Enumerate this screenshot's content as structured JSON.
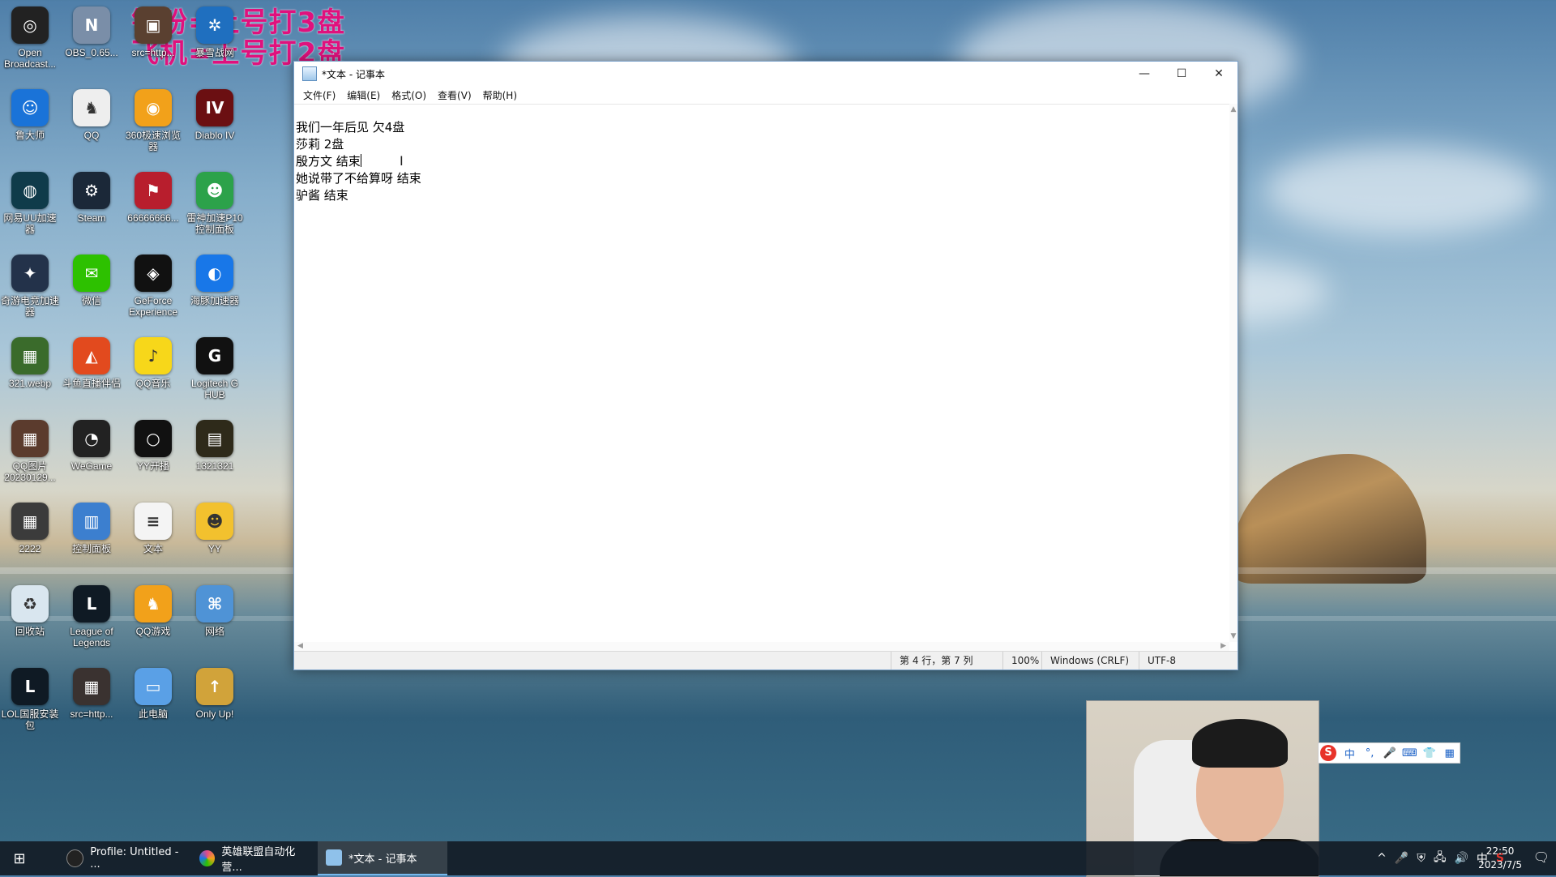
{
  "overlay": {
    "line1": "钻粉=上号打3盘",
    "line2": "飞机=上号打2盘"
  },
  "desktop_icons": [
    {
      "label": "Open Broadcast...",
      "color": "#222222",
      "glyph": "◎"
    },
    {
      "label": "OBS_0.65...",
      "color": "#7a8ea8",
      "glyph": "N"
    },
    {
      "label": "src=http...",
      "color": "#5a4030",
      "glyph": "▣"
    },
    {
      "label": "暴雪战网",
      "color": "#1f6fbf",
      "glyph": "✲"
    },
    {
      "label": "鲁大师",
      "color": "#1a73d8",
      "glyph": "☺"
    },
    {
      "label": "QQ",
      "color": "#eeeeee",
      "glyph": "♞"
    },
    {
      "label": "360极速浏览器",
      "color": "#f2a11a",
      "glyph": "◉"
    },
    {
      "label": "Diablo IV",
      "color": "#6b0f12",
      "glyph": "IV"
    },
    {
      "label": "网易UU加速器",
      "color": "#0f3b4a",
      "glyph": "◍"
    },
    {
      "label": "Steam",
      "color": "#1b2838",
      "glyph": "⚙"
    },
    {
      "label": "66666666...",
      "color": "#b81e2d",
      "glyph": "⚑"
    },
    {
      "label": "雷神加速P10控制面板",
      "color": "#2ca24a",
      "glyph": "☻"
    },
    {
      "label": "奇游电竞加速器",
      "color": "#23324a",
      "glyph": "✦"
    },
    {
      "label": "微信",
      "color": "#2dc100",
      "glyph": "✉"
    },
    {
      "label": "GeForce Experience",
      "color": "#111111",
      "glyph": "◈"
    },
    {
      "label": "海豚加速器",
      "color": "#1877e8",
      "glyph": "◐"
    },
    {
      "label": "321.webp",
      "color": "#3a6b2b",
      "glyph": "▦"
    },
    {
      "label": "斗鱼直播伴侣",
      "color": "#e24a1e",
      "glyph": "◭"
    },
    {
      "label": "QQ音乐",
      "color": "#f7d71a",
      "glyph": "♪"
    },
    {
      "label": "Logitech G HUB",
      "color": "#111111",
      "glyph": "G"
    },
    {
      "label": "QQ图片20230129...",
      "color": "#5b3b2d",
      "glyph": "▦"
    },
    {
      "label": "WeGame",
      "color": "#222222",
      "glyph": "◔"
    },
    {
      "label": "YY开播",
      "color": "#111111",
      "glyph": "○"
    },
    {
      "label": "1321321",
      "color": "#2e2a1a",
      "glyph": "▤"
    },
    {
      "label": "2222",
      "color": "#3b3b3b",
      "glyph": "▦"
    },
    {
      "label": "控制面板",
      "color": "#3c7fcf",
      "glyph": "▥"
    },
    {
      "label": "文本",
      "color": "#f4f4f4",
      "glyph": "≡"
    },
    {
      "label": "YY",
      "color": "#f2c12e",
      "glyph": "☻"
    },
    {
      "label": "回收站",
      "color": "#d9e6ef",
      "glyph": "♻"
    },
    {
      "label": "League of Legends",
      "color": "#0f1a24",
      "glyph": "L"
    },
    {
      "label": "QQ游戏",
      "color": "#f2a11a",
      "glyph": "♞"
    },
    {
      "label": "网络",
      "color": "#4f93d6",
      "glyph": "⌘"
    },
    {
      "label": "LOL国服安装包",
      "color": "#0f1a24",
      "glyph": "L"
    },
    {
      "label": "src=http...",
      "color": "#3a3230",
      "glyph": "▦"
    },
    {
      "label": "此电脑",
      "color": "#5aa0e6",
      "glyph": "▭"
    },
    {
      "label": "Only Up!",
      "color": "#d1a33a",
      "glyph": "↑"
    }
  ],
  "notepad": {
    "title": "*文本 - 记事本",
    "controls": {
      "minimize": "—",
      "maximize": "☐",
      "close": "✕"
    },
    "menu": [
      "文件(F)",
      "编辑(E)",
      "格式(O)",
      "查看(V)",
      "帮助(H)"
    ],
    "lines": [
      "我们一年后见 欠4盘",
      "莎莉 2盘",
      "殷方文 结束",
      "她说带了不给算呀 结束",
      "驴酱 结束"
    ],
    "status": {
      "position": "第 4 行，第 7 列",
      "zoom": "100%",
      "line_ending": "Windows (CRLF)",
      "encoding": "UTF-8"
    }
  },
  "ime": {
    "logo": "S",
    "items": [
      "中",
      "°,",
      "🎤",
      "⌨",
      "👕",
      "▦"
    ]
  },
  "taskbar": {
    "start_icon": "⊞",
    "tasks": [
      {
        "label": "Profile: Untitled - ...",
        "color": "#222222"
      },
      {
        "label": "英雄联盟自动化营...",
        "color": "#e24a8a"
      },
      {
        "label": "*文本 - 记事本",
        "color": "#8fc1ea"
      }
    ],
    "tray_icons": [
      "^",
      "🎤",
      "⛨",
      "🖧",
      "🔊",
      "中",
      "S"
    ],
    "time": "22:50",
    "date": "2023/7/5",
    "notify": "🗨"
  }
}
